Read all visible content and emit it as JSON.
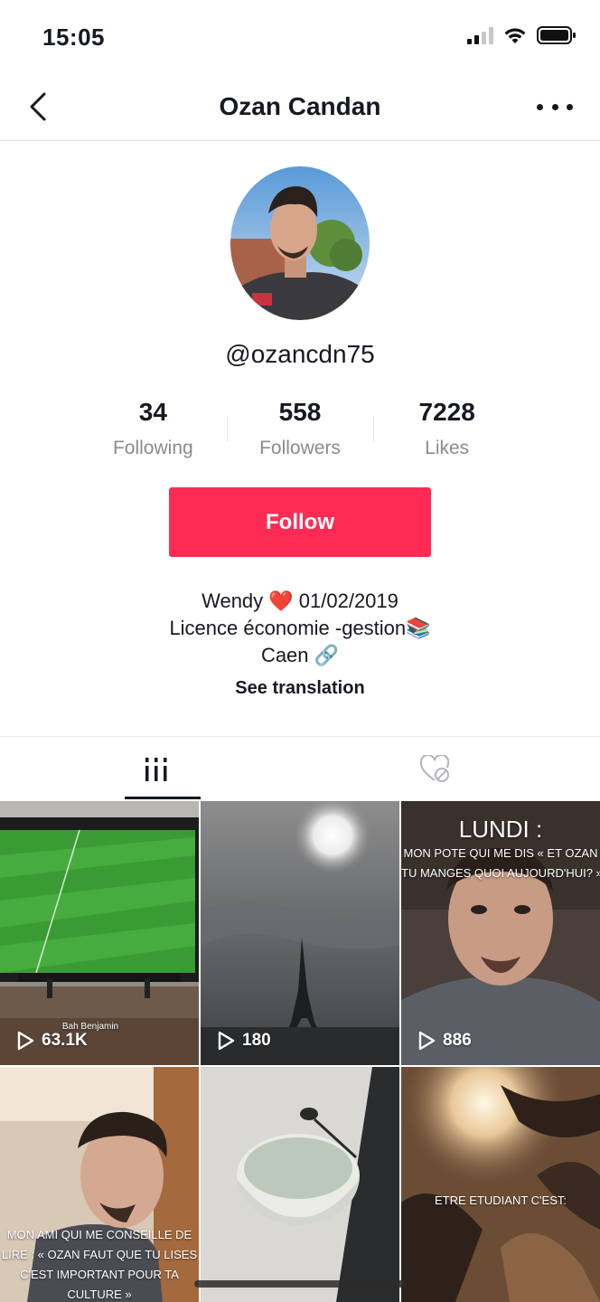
{
  "status_bar": {
    "time": "15:05",
    "icons": [
      "cellular-signal-icon",
      "wifi-icon",
      "battery-icon"
    ]
  },
  "nav": {
    "title": "Ozan Candan",
    "back_icon": "chevron-left-icon",
    "more_icon": "more-dots-icon"
  },
  "profile": {
    "username": "@ozancdn75",
    "stats": [
      {
        "value": "34",
        "label": "Following"
      },
      {
        "value": "558",
        "label": "Followers"
      },
      {
        "value": "7228",
        "label": "Likes"
      }
    ],
    "follow_label": "Follow",
    "bio_lines": [
      "Wendy ❤️ 01/02/2019",
      "Licence économie -gestion📚",
      "Caen 🔗"
    ],
    "see_translation": "See translation"
  },
  "tabs": [
    {
      "name": "videos",
      "icon": "grid-bars-icon",
      "active": true
    },
    {
      "name": "liked",
      "icon": "liked-hidden-heart-icon",
      "active": false
    }
  ],
  "videos": [
    {
      "plays": "63.1K",
      "caption": "Bah Benjamin",
      "thumbnail": "football-on-tv"
    },
    {
      "plays": "180",
      "caption": "",
      "thumbnail": "eiffel-tower-sky"
    },
    {
      "plays": "886",
      "caption_title": "LUNDI :",
      "caption_lines": [
        "MON POTE QUI ME DIS « ET OZAN",
        "TU MANGES QUOI AUJOURD'HUI? »"
      ],
      "thumbnail": "selfie"
    },
    {
      "plays": "",
      "caption_lines": [
        "MON AMI QUI ME CONSEILLE DE",
        "LIRE : « OZAN FAUT QUE TU LISES",
        "C'EST IMPORTANT POUR TA",
        "CULTURE »"
      ],
      "thumbnail": "portrait"
    },
    {
      "plays": "",
      "caption": "",
      "thumbnail": "empty-bowl"
    },
    {
      "plays": "",
      "caption_lines": [
        "ETRE ETUDIANT C'EST:"
      ],
      "thumbnail": "lamp-room"
    }
  ],
  "colors": {
    "accent": "#fe2c55",
    "text": "#161823",
    "muted": "#8a8b91"
  }
}
